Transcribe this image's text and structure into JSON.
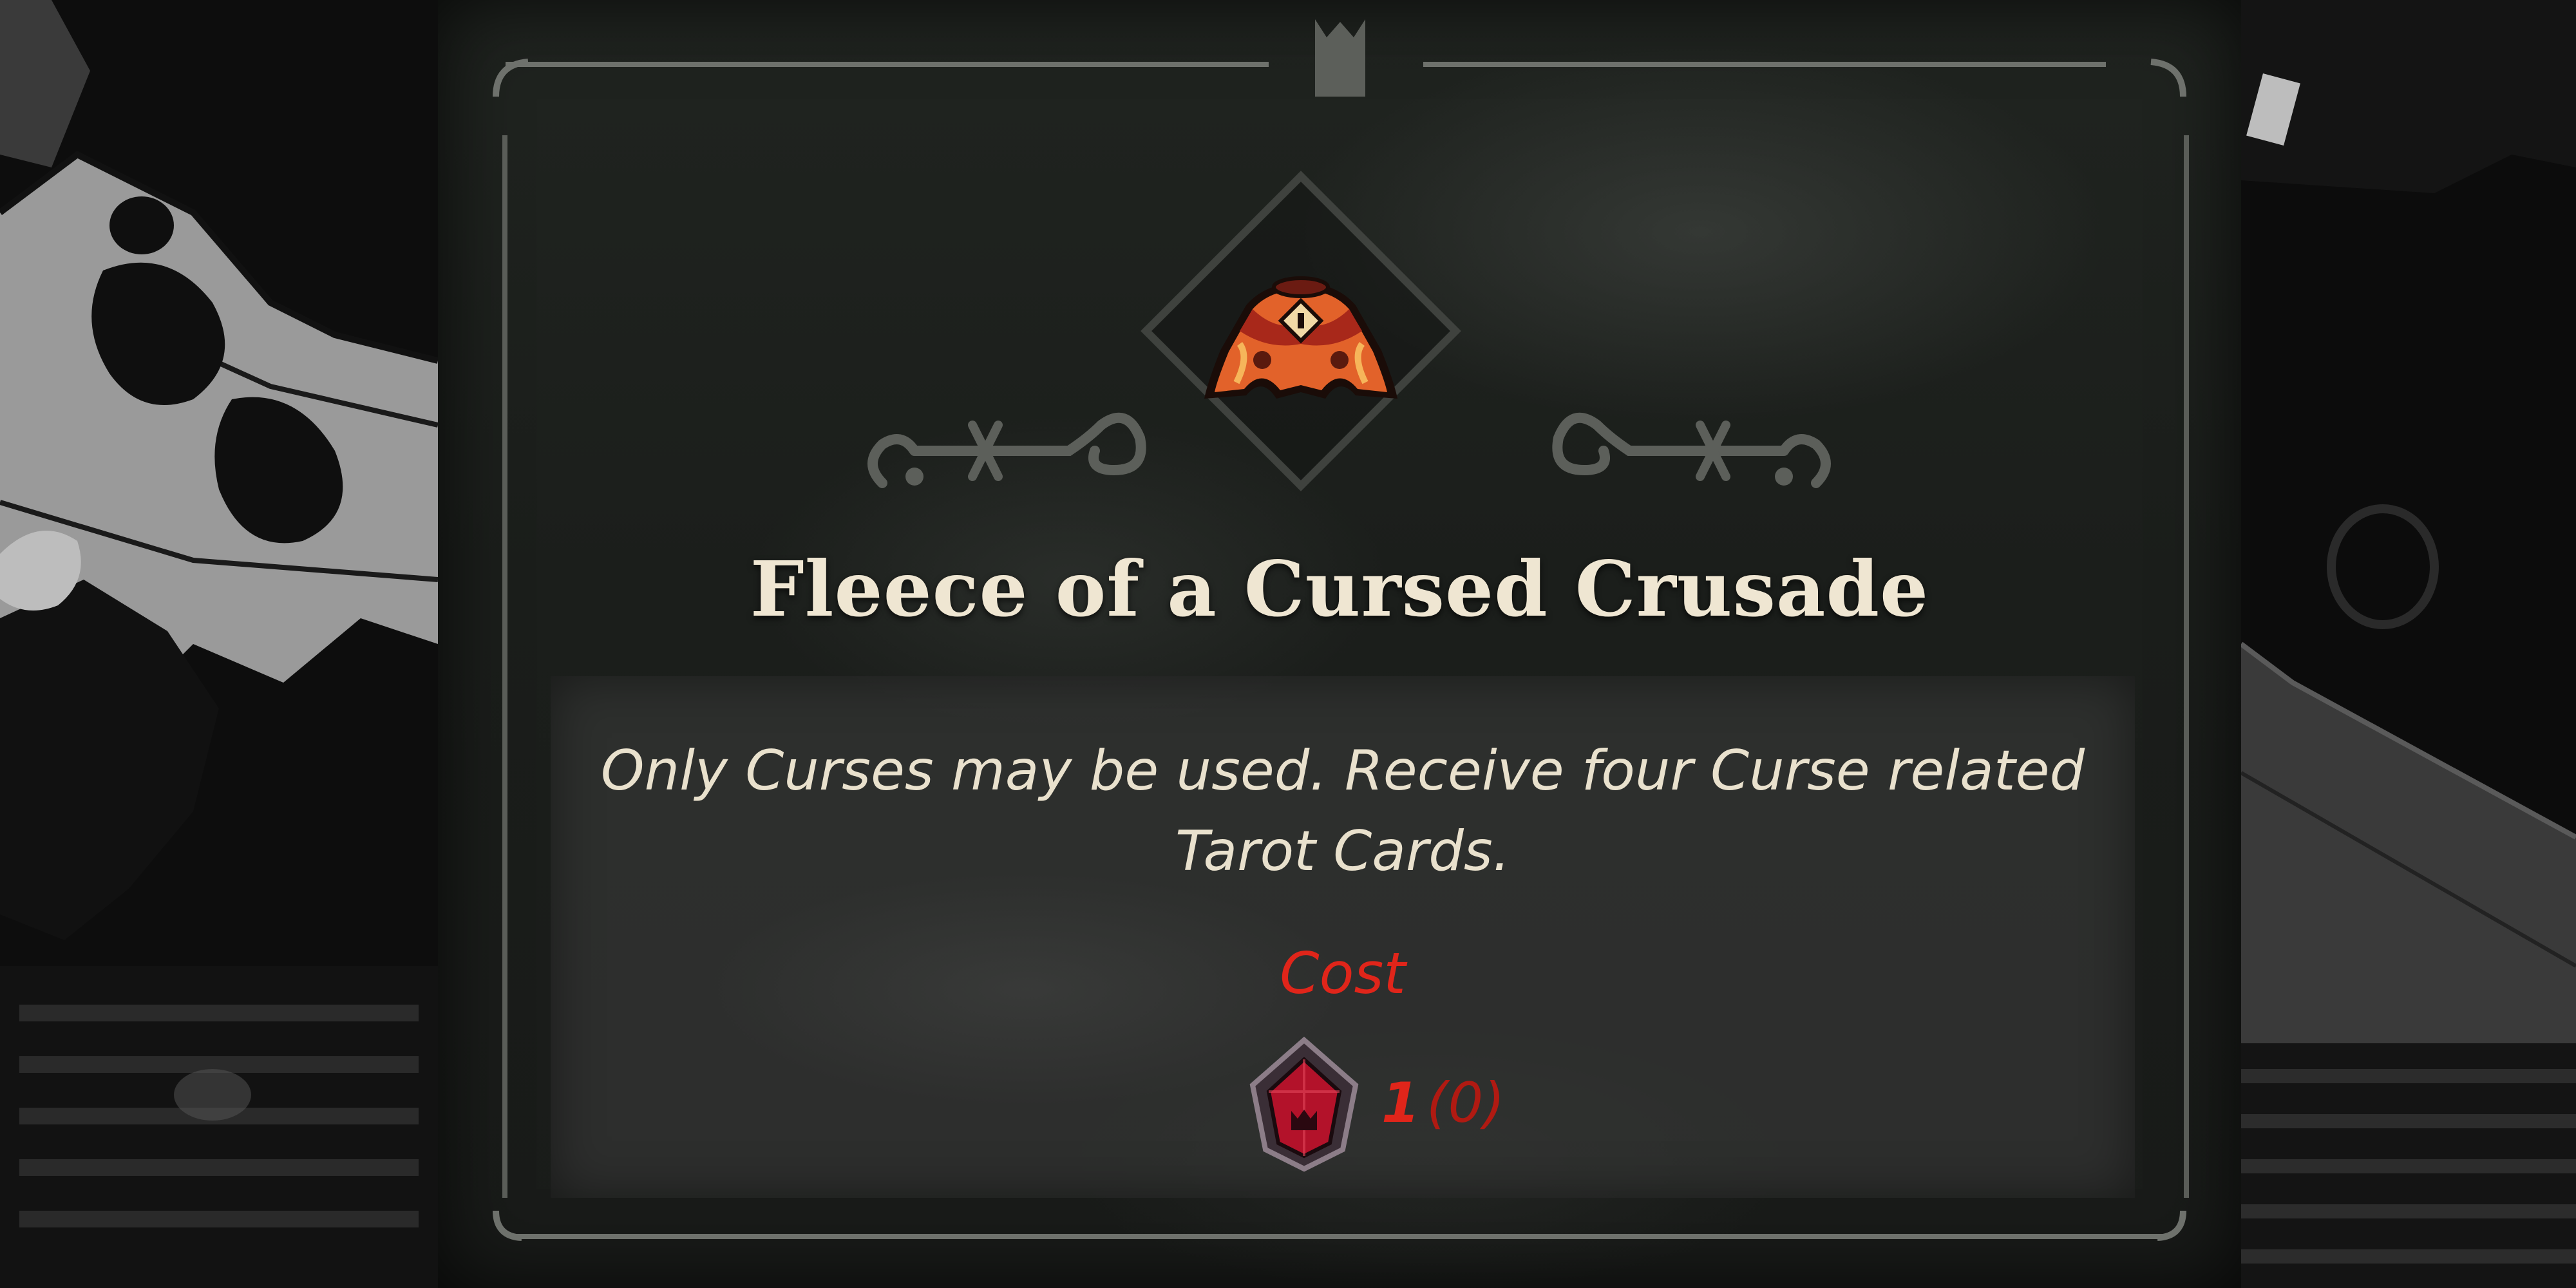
{
  "item": {
    "title": "Fleece of a Cursed Crusade",
    "icon": "fleece-cape-icon",
    "description_lines": [
      "Only Curses may be used. Receive four Curse related",
      "Tarot Cards."
    ]
  },
  "cost": {
    "label": "Cost",
    "currency_icon": "red-gem-icon",
    "amount": "1",
    "owned": "(0)"
  },
  "colors": {
    "title": "#efe6d2",
    "description": "#e9e1cd",
    "cost_red": "#e0251a",
    "panel_bg": "#1d201d",
    "frame_line": "#6e716c"
  }
}
